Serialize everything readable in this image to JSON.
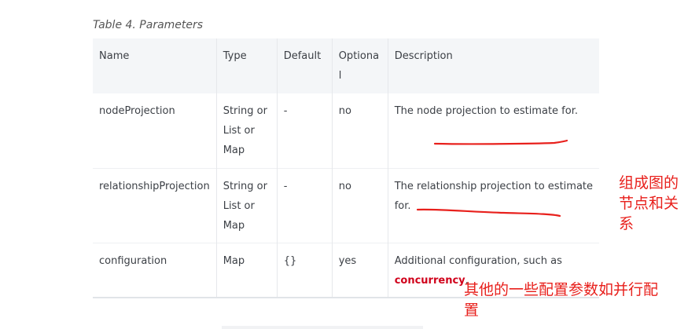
{
  "table": {
    "caption": "Table 4. Parameters",
    "headers": {
      "name": "Name",
      "type": "Type",
      "default": "Default",
      "optional_a": "Optiona",
      "optional_b": "l",
      "description": "Description"
    },
    "rows": [
      {
        "name": "nodeProjection",
        "type": [
          "String or",
          "List or",
          "Map"
        ],
        "default": "-",
        "optional": "no",
        "description": [
          "The node projection to estimate for."
        ]
      },
      {
        "name": "relationshipProjection",
        "type": [
          "String or",
          "List or",
          "Map"
        ],
        "default": "-",
        "optional": "no",
        "description": [
          "The relationship projection to estimate",
          "for."
        ]
      },
      {
        "name": "configuration",
        "type": [
          "Map"
        ],
        "default": "{}",
        "optional": "yes",
        "description_prefix": "Additional configuration, such as",
        "description_code": "concurrency",
        "description_suffix": "."
      }
    ]
  },
  "annotations": {
    "note1": [
      "组成图的",
      "节点和关",
      "系"
    ],
    "note2": [
      "其他的一些配置参数如并行配",
      "置"
    ],
    "color": "#e8201c"
  }
}
